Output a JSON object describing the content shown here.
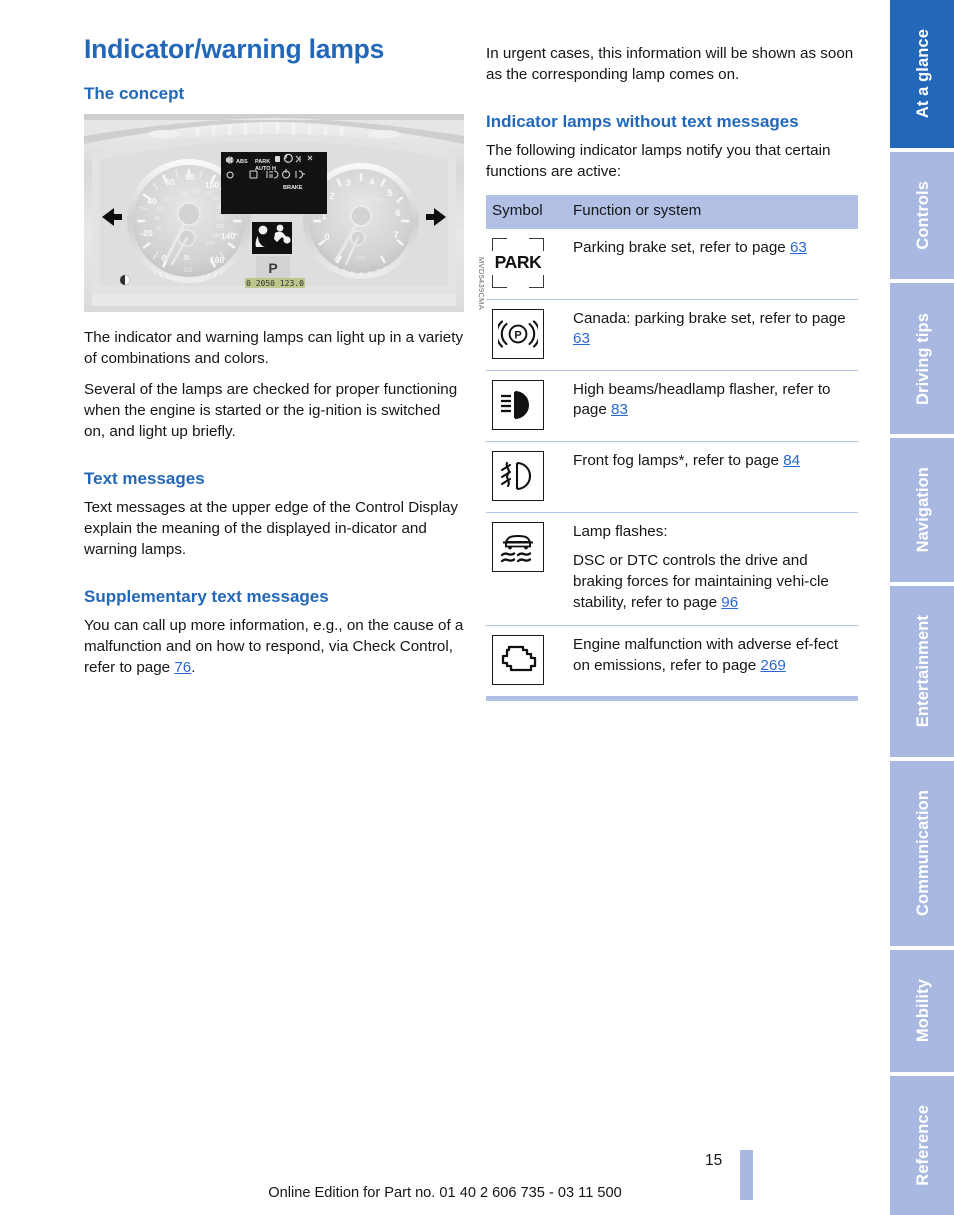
{
  "document": {
    "title": "Indicator/warning lamps",
    "page_number": "15",
    "footer": "Online Edition for Part no. 01 40 2 606 735 - 03 11 500"
  },
  "left_column": {
    "concept": {
      "heading": "The concept",
      "figure_credit": "MVD5439CMA",
      "paragraphs": [
        "The indicator and warning lamps can light up in a variety of combinations and colors.",
        "Several of the lamps are checked for proper functioning when the engine is started or the ig-nition is switched on, and light up briefly."
      ]
    },
    "text_messages": {
      "heading": "Text messages",
      "paragraphs": [
        "Text messages at the upper edge of the Control Display explain the meaning of the displayed in-dicator and warning lamps."
      ]
    },
    "supplementary": {
      "heading": "Supplementary text messages",
      "text_before": "You can call up more information, e.g., on the cause of a malfunction and on how to respond, via Check Control, refer to page ",
      "page_ref": "76",
      "text_after": "."
    }
  },
  "right_column": {
    "intro": "In urgent cases, this information will be shown as soon as the corresponding lamp comes on.",
    "indicator_lamps": {
      "heading": "Indicator lamps without text messages",
      "intro": "The following indicator lamps notify you that certain functions are active:"
    },
    "table": {
      "headers": {
        "symbol": "Symbol",
        "function": "Function or system"
      },
      "rows": [
        {
          "icon": "park-brake-text-icon",
          "icon_text": "PARK",
          "lines": [
            {
              "text_before": "Parking brake set, refer to page ",
              "page_ref": "63",
              "text_after": ""
            }
          ]
        },
        {
          "icon": "park-brake-canada-icon",
          "icon_text": "((P))",
          "lines": [
            {
              "text_before": "Canada: parking brake set, refer to page ",
              "page_ref": "63",
              "text_after": ""
            }
          ]
        },
        {
          "icon": "high-beam-icon",
          "icon_text": "",
          "lines": [
            {
              "text_before": "High beams/headlamp flasher, refer to page ",
              "page_ref": "83",
              "text_after": ""
            }
          ]
        },
        {
          "icon": "front-fog-lamp-icon",
          "icon_text": "",
          "lines": [
            {
              "text_before": "Front fog lamps*, refer to page ",
              "page_ref": "84",
              "text_after": ""
            }
          ]
        },
        {
          "icon": "dsc-dtc-skid-icon",
          "icon_text": "",
          "lines": [
            {
              "text_before": "Lamp flashes:",
              "page_ref": "",
              "text_after": ""
            },
            {
              "text_before": "DSC or DTC controls the drive and braking forces for maintaining vehi-cle stability, refer to page ",
              "page_ref": "96",
              "text_after": ""
            }
          ]
        },
        {
          "icon": "engine-malfunction-icon",
          "icon_text": "",
          "lines": [
            {
              "text_before": "Engine malfunction with adverse ef-fect on emissions, refer to page ",
              "page_ref": "269",
              "text_after": ""
            }
          ]
        }
      ]
    }
  },
  "sidebar": {
    "tabs": [
      {
        "label": "At a glance",
        "active": true
      },
      {
        "label": "Controls",
        "active": false
      },
      {
        "label": "Driving tips",
        "active": false
      },
      {
        "label": "Navigation",
        "active": false
      },
      {
        "label": "Entertainment",
        "active": false
      },
      {
        "label": "Communication",
        "active": false
      },
      {
        "label": "Mobility",
        "active": false
      },
      {
        "label": "Reference",
        "active": false
      }
    ]
  },
  "colors": {
    "heading_blue": "#2368b8",
    "link_blue": "#2a68d0",
    "tab_inactive": "#a8b8e0",
    "tab_active": "#2368b8",
    "table_header_bg": "#b3c0e6"
  }
}
